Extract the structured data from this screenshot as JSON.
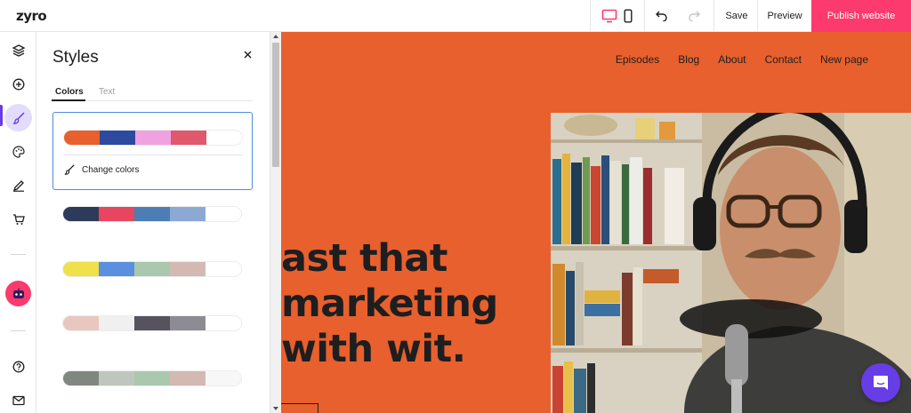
{
  "app": {
    "logo": "zyro"
  },
  "topbar": {
    "save_label": "Save",
    "preview_label": "Preview",
    "publish_label": "Publish website",
    "publish_color": "#fc3a6d",
    "device_icons": [
      "desktop-icon",
      "mobile-icon"
    ],
    "history_icons": [
      "undo-icon",
      "redo-icon"
    ]
  },
  "rail": {
    "items": [
      "layers-icon",
      "add-element-icon",
      "brush-icon",
      "palette-icon",
      "pen-icon",
      "cart-icon",
      "ai-robot-icon",
      "help-icon",
      "mail-icon"
    ],
    "active": "brush-icon"
  },
  "panel": {
    "title": "Styles",
    "tabs": [
      {
        "label": "Colors",
        "active": true
      },
      {
        "label": "Text",
        "active": false
      }
    ],
    "change_colors_label": "Change colors",
    "palettes": [
      {
        "selected": true,
        "colors": [
          "#e8602d",
          "#2e4a9e",
          "#f0a2e0",
          "#e0586c",
          "#ffffff"
        ]
      },
      {
        "selected": false,
        "colors": [
          "#2d3a5a",
          "#e8455f",
          "#4c7db4",
          "#8ba9d3",
          "#ffffff"
        ]
      },
      {
        "selected": false,
        "colors": [
          "#f0e04a",
          "#5b8fe0",
          "#a9c8ad",
          "#d3b9b1",
          "#ffffff"
        ]
      },
      {
        "selected": false,
        "colors": [
          "#e9c7be",
          "#f0f0f0",
          "#56535f",
          "#8d8c94",
          "#ffffff"
        ]
      },
      {
        "selected": false,
        "colors": [
          "#808780",
          "#bfc6bd",
          "#a9c8ad",
          "#d3b9b1",
          "#f7f7f7"
        ]
      }
    ]
  },
  "site": {
    "background": "#e8602d",
    "nav": [
      "Episodes",
      "Blog",
      "About",
      "Contact",
      "New page"
    ],
    "hero_lines": [
      "ast that",
      "marketing",
      "with wit."
    ]
  }
}
